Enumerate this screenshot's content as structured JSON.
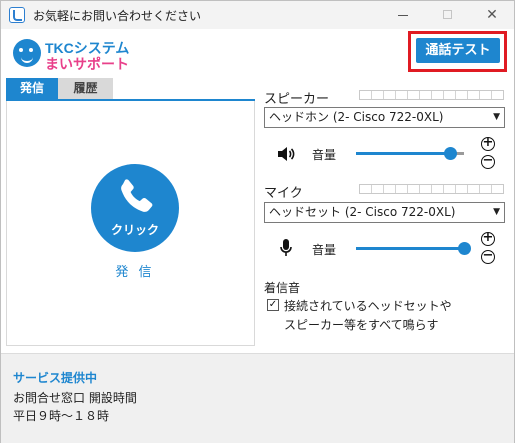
{
  "window": {
    "title": "お気軽にお問い合わせください"
  },
  "logo": {
    "line1": "TKCシステム",
    "line2": "まいサポート"
  },
  "toolbar": {
    "call_test_label": "通話テスト"
  },
  "tabs": [
    {
      "label": "発信",
      "active": true
    },
    {
      "label": "履歴",
      "active": false
    }
  ],
  "call": {
    "button_label": "クリック",
    "caption": "発 信"
  },
  "speaker": {
    "label": "スピーカー",
    "device": "ヘッドホン (2- Cisco 722-0XL)",
    "volume_label": "音量",
    "volume_level": 0.87
  },
  "mic": {
    "label": "マイク",
    "device": "ヘッドセット (2- Cisco 722-0XL)",
    "volume_label": "音量",
    "volume_level": 1.0
  },
  "ringtone": {
    "label": "着信音",
    "checked": true,
    "text_line1": "接続されているヘッドセットや",
    "text_line2": "スピーカー等をすべて鳴らす"
  },
  "footer": {
    "status": "サービス提供中",
    "line1": "お問合せ窓口 開設時間",
    "line2": "平日９時～１８時"
  },
  "colors": {
    "accent": "#1e86cf",
    "highlight": "#e01b23",
    "brand_pink": "#e8408a"
  }
}
